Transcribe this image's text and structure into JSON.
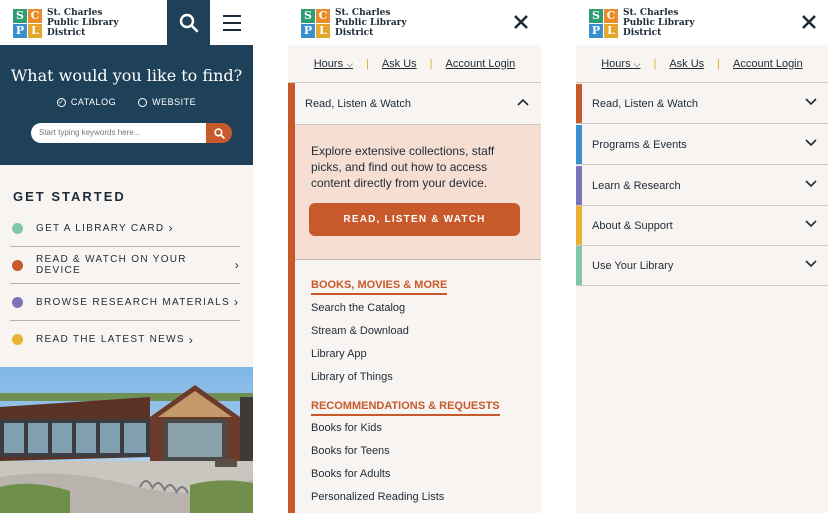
{
  "logo": {
    "line1": "St. Charles",
    "line2": "Public Library",
    "line3": "District",
    "letters": [
      "S",
      "C",
      "P",
      "L"
    ]
  },
  "home": {
    "find_title": "What would you like to find?",
    "radio_catalog": "CATALOG",
    "radio_website": "WEBSITE",
    "search_placeholder": "Start typing keywords here...",
    "get_started": "GET STARTED",
    "items": [
      {
        "label": "GET A LIBRARY CARD",
        "color": "#7fc7a8"
      },
      {
        "label": "READ & WATCH ON YOUR DEVICE",
        "color": "#c8592a"
      },
      {
        "label": "BROWSE RESEARCH MATERIALS",
        "color": "#7c74b8"
      },
      {
        "label": "READ THE LATEST NEWS",
        "color": "#e9b233"
      }
    ]
  },
  "utility": {
    "hours": "Hours",
    "ask": "Ask Us",
    "login": "Account Login"
  },
  "expanded": {
    "section": "Read, Listen & Watch",
    "promo": "Explore extensive collections, staff picks, and find out how to access content directly from your device.",
    "cta": "READ, LISTEN & WATCH",
    "group1": "BOOKS, MOVIES & MORE",
    "group1_links": [
      "Search the Catalog",
      "Stream & Download",
      "Library App",
      "Library of Things"
    ],
    "group2": "RECOMMENDATIONS & REQUESTS",
    "group2_links": [
      "Books for Kids",
      "Books for Teens",
      "Books for Adults",
      "Personalized Reading Lists"
    ]
  },
  "menu": [
    {
      "label": "Read, Listen & Watch",
      "color": "#c8592a"
    },
    {
      "label": "Programs & Events",
      "color": "#3b8fcf"
    },
    {
      "label": "Learn & Research",
      "color": "#7c74b8"
    },
    {
      "label": "About & Support",
      "color": "#e9b233"
    },
    {
      "label": "Use Your Library",
      "color": "#7fc7a8"
    }
  ]
}
